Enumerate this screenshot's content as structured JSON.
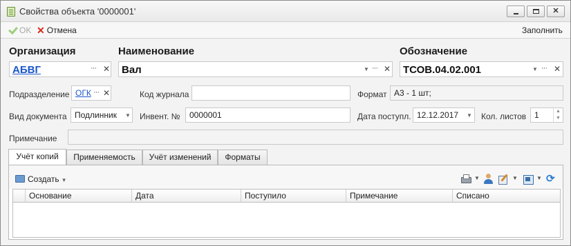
{
  "window": {
    "title": "Свойства объекта '0000001'"
  },
  "toolbar": {
    "ok_label": "OK",
    "cancel_label": "Отмена",
    "fill_label": "Заполнить"
  },
  "header": {
    "organization_label": "Организация",
    "organization_value": "АБВГ",
    "name_label": "Наименование",
    "name_value": "Вал",
    "designation_label": "Обозначение",
    "designation_value": "ТСОВ.04.02.001"
  },
  "form": {
    "division_label": "Подразделение",
    "division_value": "ОГК",
    "journal_code_label": "Код журнала",
    "journal_code_value": "",
    "format_label": "Формат",
    "format_value": "А3 - 1 шт;",
    "doc_type_label": "Вид документа",
    "doc_type_value": "Подлинник",
    "inventory_label": "Инвент. №",
    "inventory_value": "0000001",
    "received_date_label": "Дата поступл.",
    "received_date_value": "12.12.2017",
    "sheet_count_label": "Кол. листов",
    "sheet_count_value": "1",
    "note_label": "Примечание",
    "note_value": ""
  },
  "tabs": [
    {
      "label": "Учёт копий",
      "active": true
    },
    {
      "label": "Применяемость",
      "active": false
    },
    {
      "label": "Учёт изменений",
      "active": false
    },
    {
      "label": "Форматы",
      "active": false
    }
  ],
  "grid": {
    "create_label": "Создать",
    "columns": [
      "Основание",
      "Дата",
      "Поступило",
      "Примечание",
      "Списано"
    ],
    "rows": []
  },
  "icons": {
    "window": "document-icon",
    "ok": "checkmark-icon",
    "cancel": "close-icon",
    "create": "create-icon",
    "print": "printer-icon",
    "user": "user-icon",
    "edit": "edit-icon",
    "view": "view-icon",
    "refresh": "refresh-icon"
  },
  "colors": {
    "link": "#1a56c8",
    "cancel_x": "#d5281b",
    "ok_check": "#9ccf7a"
  }
}
